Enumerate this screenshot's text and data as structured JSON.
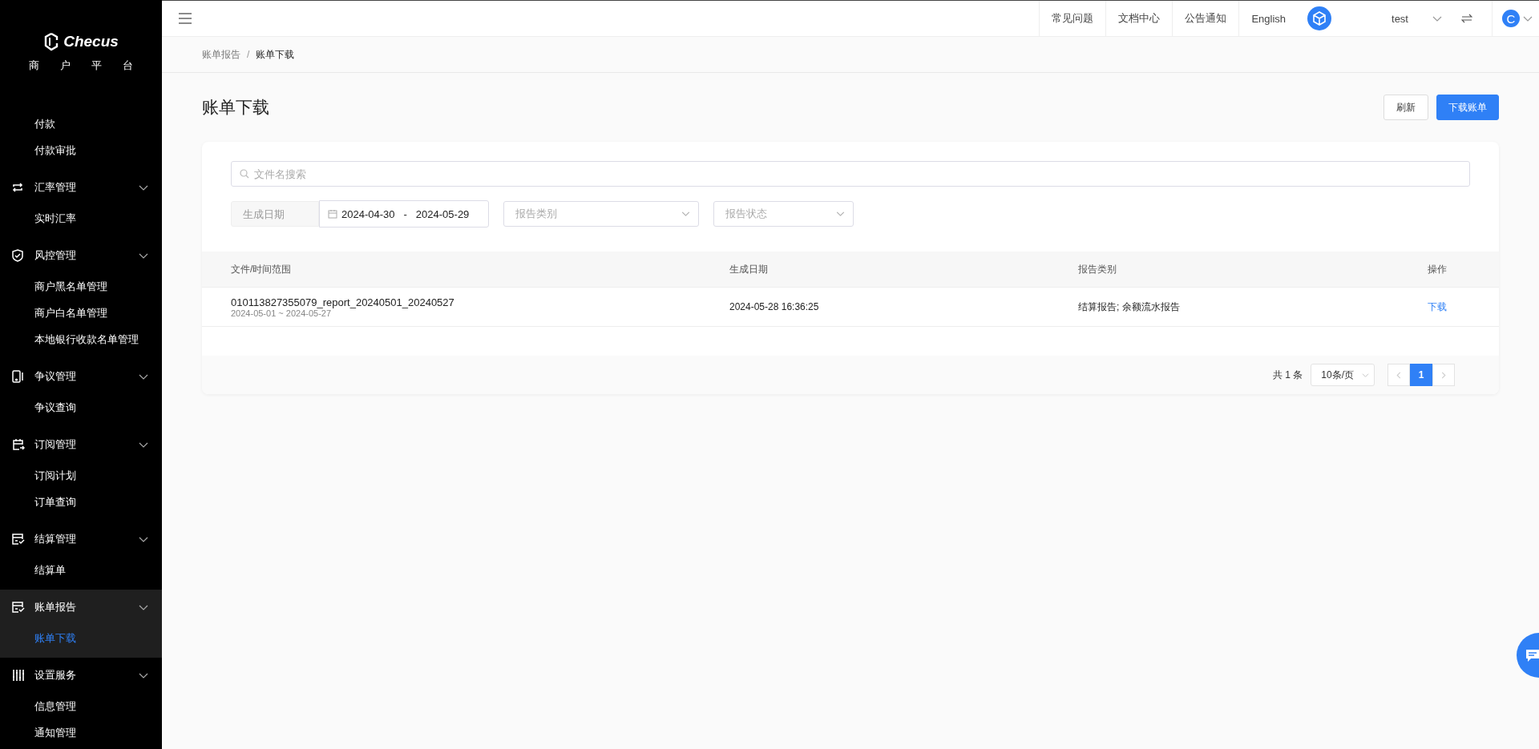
{
  "sidebar": {
    "logo": "Checus",
    "subtitle": [
      "商",
      "户",
      "平",
      "台"
    ],
    "groups": [
      {
        "active": false,
        "items": [
          {
            "label": "付款",
            "selected": false
          },
          {
            "label": "付款审批",
            "selected": false
          }
        ]
      },
      {
        "title": "汇率管理",
        "expanded": true,
        "active": false,
        "items": [
          {
            "label": "实时汇率",
            "selected": false
          }
        ]
      },
      {
        "title": "风控管理",
        "expanded": true,
        "active": false,
        "items": [
          {
            "label": "商户黑名单管理",
            "selected": false
          },
          {
            "label": "商户白名单管理",
            "selected": false
          },
          {
            "label": "本地银行收款名单管理",
            "selected": false
          }
        ]
      },
      {
        "title": "争议管理",
        "expanded": true,
        "active": false,
        "items": [
          {
            "label": "争议查询",
            "selected": false
          }
        ]
      },
      {
        "title": "订阅管理",
        "expanded": true,
        "active": false,
        "items": [
          {
            "label": "订阅计划",
            "selected": false
          },
          {
            "label": "订单查询",
            "selected": false
          }
        ]
      },
      {
        "title": "结算管理",
        "expanded": true,
        "active": false,
        "items": [
          {
            "label": "结算单",
            "selected": false
          }
        ]
      },
      {
        "title": "账单报告",
        "expanded": true,
        "active": true,
        "items": [
          {
            "label": "账单下载",
            "selected": true
          }
        ]
      },
      {
        "title": "设置服务",
        "expanded": true,
        "active": false,
        "items": [
          {
            "label": "信息管理",
            "selected": false
          },
          {
            "label": "通知管理",
            "selected": false
          }
        ]
      }
    ]
  },
  "topbar": {
    "links": [
      "常见问题",
      "文档中心",
      "公告通知",
      "English"
    ],
    "account": "test",
    "user_initial": "C"
  },
  "breadcrumb": [
    "账单报告",
    "账单下载"
  ],
  "breadcrumb_separator": "/",
  "page": {
    "title": "账单下载",
    "buttons": [
      {
        "label": "刷新",
        "kind": "default"
      },
      {
        "label": "下载账单",
        "kind": "primary"
      }
    ]
  },
  "filters": {
    "search": {
      "placeholder": "文件名搜索"
    },
    "date_label": "生成日期",
    "date_from": "2024-04-30",
    "date_sep": "-",
    "date_to": "2024-05-29",
    "type": {
      "placeholder": "报告类别"
    },
    "status": {
      "placeholder": "报告状态"
    }
  },
  "table": {
    "columns": [
      "文件/时间范围",
      "生成日期",
      "报告类别",
      "操作"
    ],
    "rows": [
      {
        "file": "010113827355079_report_20240501_20240527",
        "range": "2024-05-01 ~ 2024-05-27",
        "date": "2024-05-28 16:36:25",
        "type": "结算报告; 余额流水报告",
        "action": "下载"
      }
    ]
  },
  "pagination": {
    "total": "共 1 条",
    "page_size": "10条/页",
    "pages": [
      {
        "label": "1",
        "selected": true
      }
    ]
  }
}
